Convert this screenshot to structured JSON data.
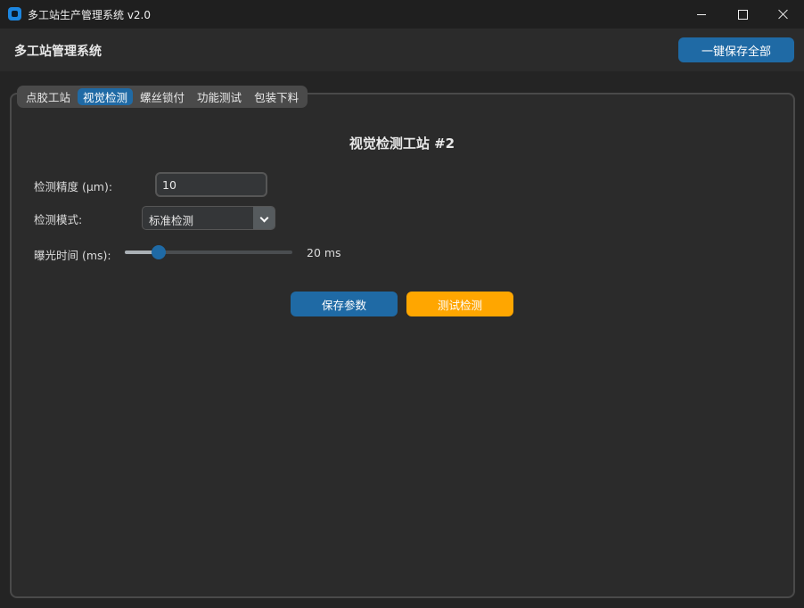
{
  "window": {
    "title": "多工站生产管理系统 v2.0"
  },
  "header": {
    "title": "多工站管理系统",
    "save_all_label": "一键保存全部"
  },
  "tabs": [
    {
      "label": "点胶工站",
      "active": false
    },
    {
      "label": "视觉检测",
      "active": true
    },
    {
      "label": "螺丝锁付",
      "active": false
    },
    {
      "label": "功能测试",
      "active": false
    },
    {
      "label": "包装下料",
      "active": false
    }
  ],
  "station": {
    "title": "视觉检测工站 #2",
    "precision_label": "检测精度 (μm):",
    "precision_value": "10",
    "mode_label": "检测模式:",
    "mode_value": "标准检测",
    "exposure_label": "曝光时间 (ms):",
    "exposure_fraction": 0.2,
    "exposure_display": "20 ms",
    "save_label": "保存参数",
    "test_label": "测试检测"
  },
  "colors": {
    "accent": "#1f6aa5",
    "warning": "#ffa600",
    "background": "#242424",
    "panel": "#2b2b2b"
  }
}
